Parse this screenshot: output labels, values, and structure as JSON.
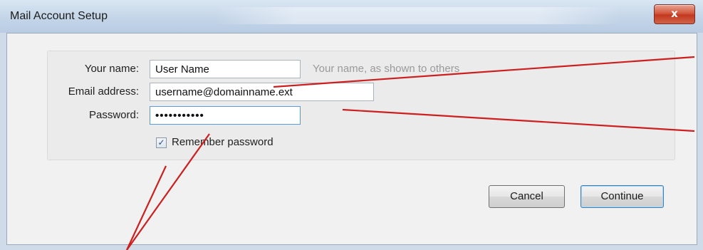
{
  "window": {
    "title": "Mail Account Setup",
    "close_label": "x"
  },
  "form": {
    "name_label": "Your name:",
    "name_value": "User Name",
    "name_hint": "Your name, as shown to others",
    "email_label": "Email address:",
    "email_value": "username@domainname.ext",
    "password_label": "Password:",
    "password_mask": "•••••••••••",
    "remember_label": "Remember password",
    "remember_checked": true
  },
  "buttons": {
    "cancel_label": "Cancel",
    "continue_label": "Continue"
  },
  "annotations": {
    "callout_color": "#cc1f1f"
  },
  "colors": {
    "title_bar": "#c4d5e8",
    "close_button": "#d3573d",
    "dialog_background": "#f1f1f1"
  }
}
